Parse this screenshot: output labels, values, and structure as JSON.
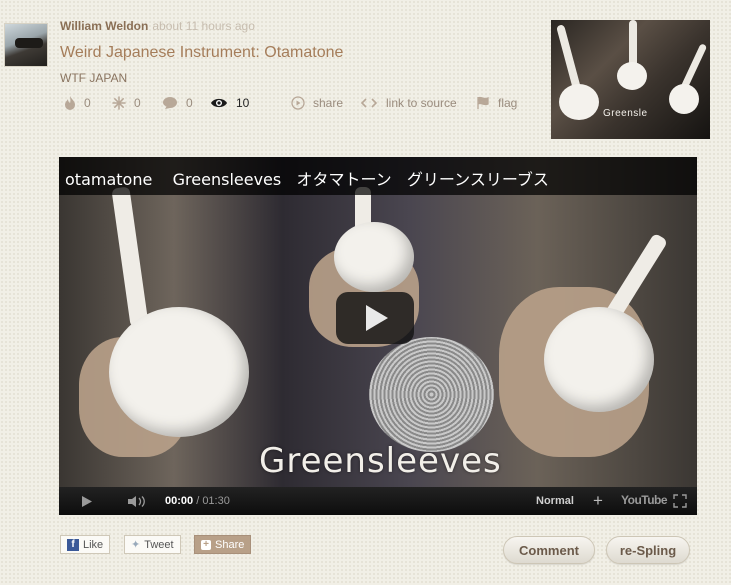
{
  "post": {
    "author": "William Weldon",
    "time": "about 11 hours ago",
    "title": "Weird Japanese Instrument: Otamatone",
    "channel": "WTF JAPAN"
  },
  "stats": {
    "likes": "0",
    "sparks": "0",
    "comments": "0",
    "views": "10",
    "share_label": "share",
    "source_label": "link to source",
    "flag_label": "flag"
  },
  "thumbnail": {
    "label": "Greensle"
  },
  "video": {
    "title": "otamatone    Greensleeves   オタマトーン   グリーンスリーブス",
    "watermark": "Greensleeves",
    "current_time": "00:00",
    "separator": " / ",
    "duration": "01:30",
    "quality": "Normal",
    "youtube_label": "YouTube"
  },
  "social": {
    "like_label": "Like",
    "tweet_label": "Tweet",
    "share_label": "Share"
  },
  "actions": {
    "comment_label": "Comment",
    "respling_label": "re-Spling"
  },
  "colors": {
    "title": "#a57d5a",
    "author": "#8a6f55",
    "facebook": "#3b5998",
    "share_button": "#b8a088"
  }
}
